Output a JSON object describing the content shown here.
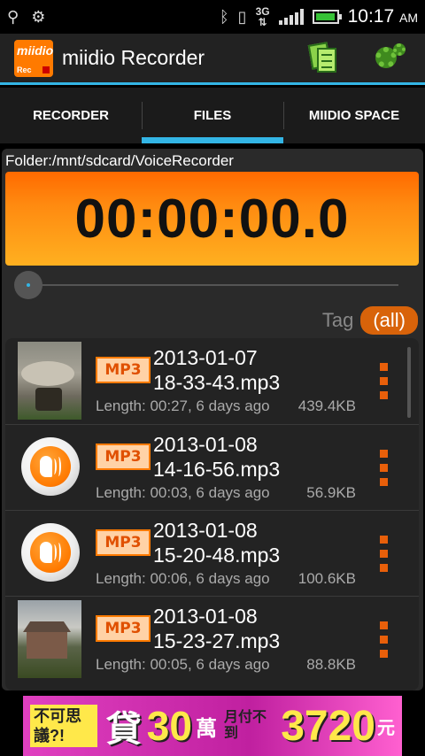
{
  "status_bar": {
    "time": "10:17",
    "ampm": "AM",
    "network": "3G",
    "icons": [
      "usb-icon",
      "debug-icon",
      "bluetooth-icon",
      "vibrate-icon",
      "network-3g-icon",
      "signal-icon",
      "battery-charging-icon"
    ]
  },
  "action_bar": {
    "logo_top": "miidio",
    "logo_bottom": "Rec",
    "title": "miidio Recorder",
    "actions": [
      "documents-icon",
      "settings-gear-icon"
    ]
  },
  "tabs": [
    {
      "label": "RECORDER",
      "active": false
    },
    {
      "label": "FILES",
      "active": true
    },
    {
      "label": "MIIDIO SPACE",
      "active": false
    }
  ],
  "player": {
    "folder": "Folder:/mnt/sdcard/VoiceRecorder",
    "timer": "00:00:00.0",
    "seek_progress": 0
  },
  "tag": {
    "label": "Tag",
    "value": "(all)"
  },
  "files": [
    {
      "thumb": "photo",
      "badge": "MP3",
      "name_line1": "2013-01-07",
      "name_line2": "18-33-43.mp3",
      "meta": "Length: 00:27, 6 days ago",
      "size": "439.4KB"
    },
    {
      "thumb": "audio",
      "badge": "MP3",
      "name_line1": "2013-01-08",
      "name_line2": "14-16-56.mp3",
      "meta": "Length: 00:03, 6 days ago",
      "size": "56.9KB"
    },
    {
      "thumb": "audio",
      "badge": "MP3",
      "name_line1": "2013-01-08",
      "name_line2": "15-20-48.mp3",
      "meta": "Length: 00:06, 6 days ago",
      "size": "100.6KB"
    },
    {
      "thumb": "photo",
      "badge": "MP3",
      "name_line1": "2013-01-08",
      "name_line2": "15-23-27.mp3",
      "meta": "Length: 00:05, 6 days ago",
      "size": "88.8KB"
    }
  ],
  "ad": {
    "part1": "不可思議?!",
    "part2": "貸",
    "part3": "30",
    "part4": "萬",
    "part5": "月付不到",
    "part6": "3720",
    "part7": "元"
  },
  "colors": {
    "accent": "#33b5e5",
    "orange": "#ff7a00",
    "menu_dot": "#e85f0a"
  }
}
